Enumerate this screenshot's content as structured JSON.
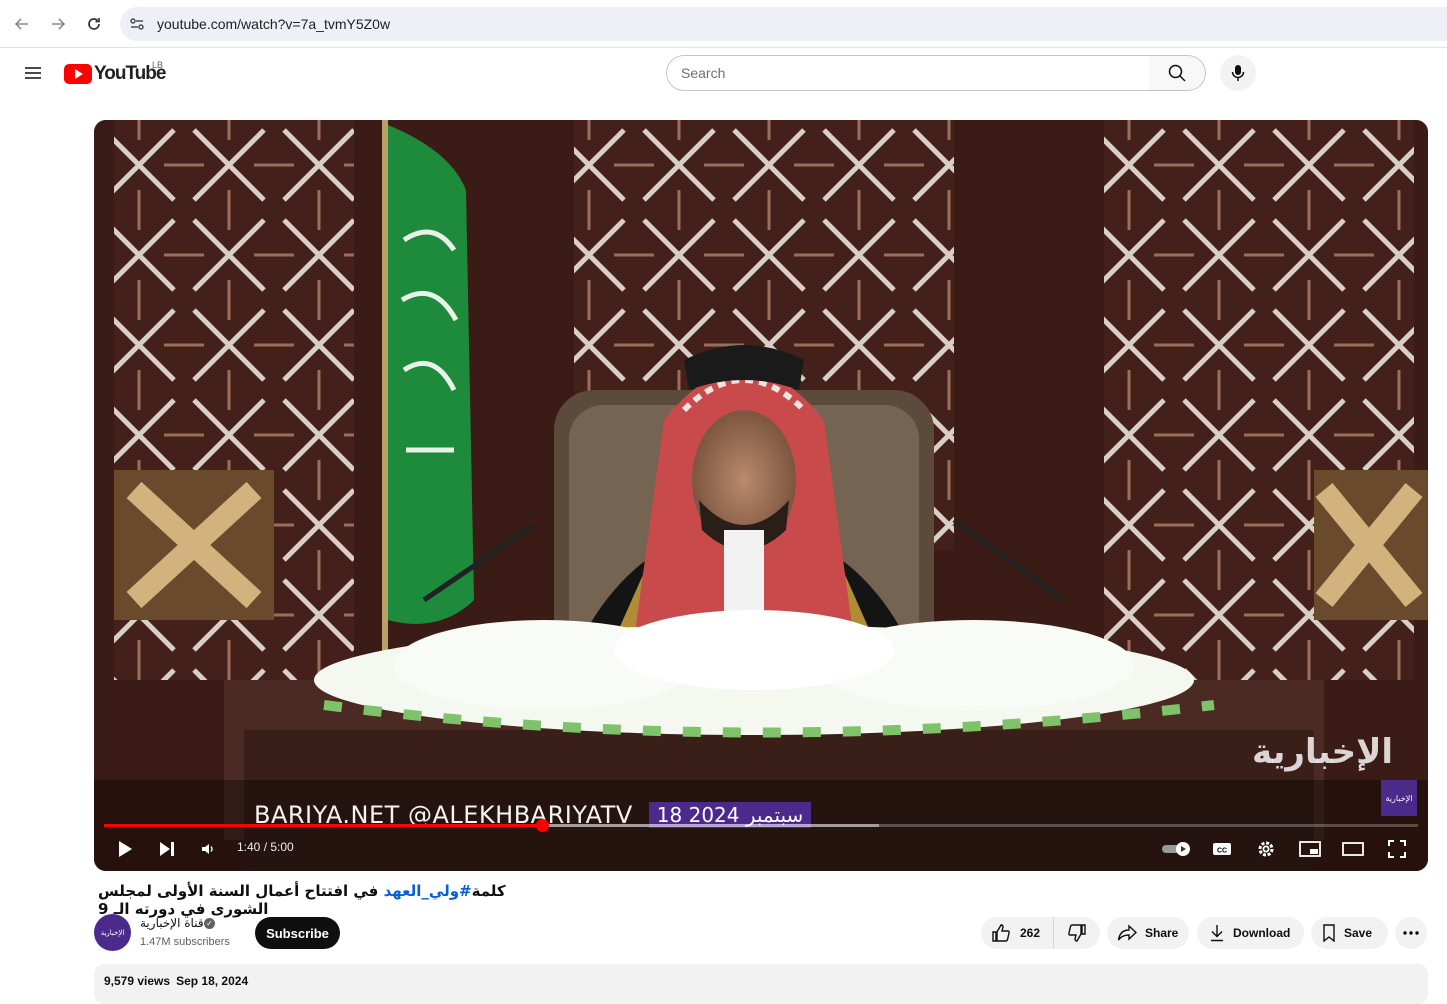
{
  "browser": {
    "url": "youtube.com/watch?v=7a_tvmY5Z0w"
  },
  "header": {
    "logo_text": "YouTube",
    "region": "LB",
    "search_placeholder": "Search"
  },
  "player": {
    "ticker_text": "BARIYA.NET   @ALEKHBARIYATV",
    "ticker_date": "18 سبتمبر 2024",
    "watermark": "الإخبارية",
    "bug_label": "الإخبارية",
    "time_current": "1:40",
    "time_total": "5:00",
    "time_display": "1:40 / 5:00",
    "progress_fraction": 0.333,
    "buffer_fraction": 0.59
  },
  "video": {
    "title_prefix": "كلمة",
    "title_hashtag": "#ولي_العهد",
    "title_rest": " في افتتاح أعمال السنة الأولى لمجلس الشورى في دورته الـ 9"
  },
  "channel": {
    "name": "قناة الإخبارية",
    "avatar_label": "الإخبارية",
    "subscribers": "1.47M subscribers",
    "subscribe_label": "Subscribe"
  },
  "actions": {
    "like_count": "262",
    "share_label": "Share",
    "download_label": "Download",
    "save_label": "Save"
  },
  "description": {
    "views": "9,579 views",
    "date": "Sep 18, 2024"
  },
  "colors": {
    "brand_red": "#ff0000",
    "channel_purple": "#4b2a8c",
    "hashtag_blue": "#065fd4"
  }
}
